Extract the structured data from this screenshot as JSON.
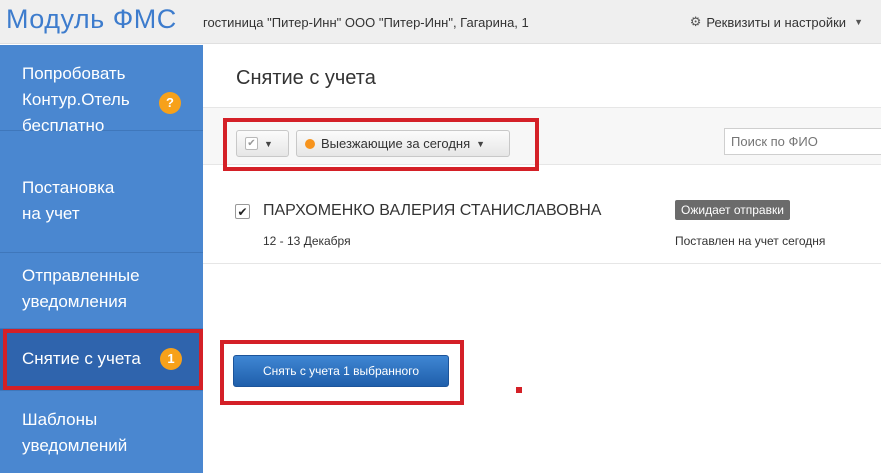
{
  "header": {
    "app_title": "Модуль ФМС",
    "org_name": "гостиница \"Питер-Инн\" ООО \"Питер-Инн\", Гагарина, 1",
    "settings_label": "Реквизиты и настройки",
    "settings_icon": "gear-icon"
  },
  "sidebar": {
    "items": [
      {
        "label_lines": [
          "Попробовать",
          "Контур.Отель",
          "бесплатно"
        ],
        "badge": "?"
      },
      {
        "label_lines": [
          "Постановка",
          "на учет"
        ]
      },
      {
        "label_lines": [
          "Отправленные",
          "уведомления"
        ]
      },
      {
        "label_lines": [
          "Снятие с учета"
        ],
        "badge": "1",
        "active": true
      },
      {
        "label_lines": [
          "Шаблоны",
          "уведомлений"
        ]
      }
    ]
  },
  "main": {
    "title": "Снятие с учета",
    "filter_label": "Выезжающие за сегодня",
    "search_placeholder": "Поиск по ФИО",
    "rows": [
      {
        "name": "ПАРХОМЕНКО ВАЛЕРИЯ СТАНИСЛАВОВНА",
        "dates": "12 - 13 Декабря",
        "status_badge": "Ожидает отправки",
        "status_text": "Поставлен на учет сегодня",
        "checked": true
      }
    ],
    "submit_label": "Снять с учета 1 выбранного"
  },
  "colors": {
    "sidebar_bg": "#4a87d0",
    "sidebar_active": "#2f64ad",
    "badge": "#f7a11a",
    "primary_button": "#2a6fc0",
    "annotation": "#d42027"
  }
}
